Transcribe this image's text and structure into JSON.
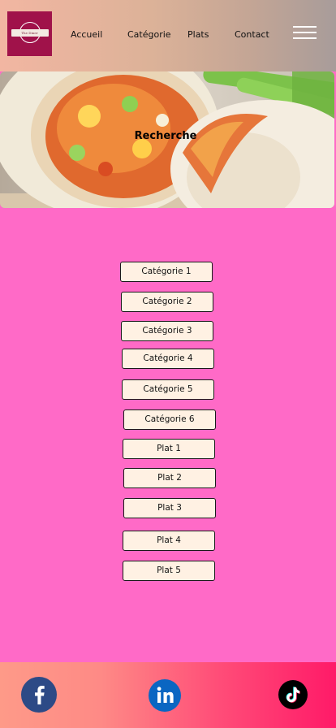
{
  "header": {
    "logo_text": "The Diner",
    "nav": [
      "Accueil",
      "Catégorie",
      "Plats",
      "Contact"
    ]
  },
  "hero": {
    "title": "Recherche"
  },
  "buttons": [
    "Catégorie 1",
    "Catégorie 2",
    "Catégorie 3",
    "Catégorie 4",
    "Catégorie 5",
    "Catégorie 6",
    "Plat 1",
    "Plat 2",
    "Plat 3",
    "Plat 4",
    "Plat 5"
  ],
  "footer": {
    "social": [
      "facebook-icon",
      "linkedin-icon",
      "tiktok-icon"
    ]
  },
  "colors": {
    "page_background": "#ff6ac7",
    "button_fill": "#fff1e3",
    "logo_background": "#a0124a",
    "facebook": "#2d4a86",
    "linkedin": "#0a66c2",
    "tiktok": "#000000"
  }
}
